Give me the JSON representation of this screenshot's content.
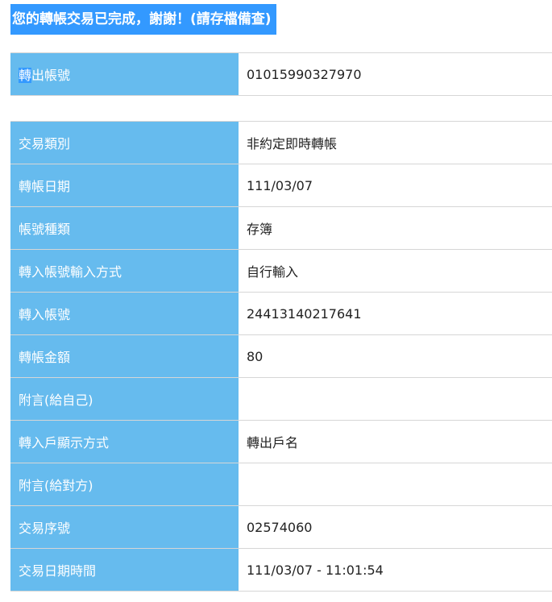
{
  "title": "您的轉帳交易已完成，謝謝！(請存檔備查)",
  "account_table": {
    "label_highlighted_char": "轉",
    "label_rest": "出帳號",
    "value": "01015990327970"
  },
  "details": [
    {
      "label": "交易類別",
      "value": "非約定即時轉帳"
    },
    {
      "label": "轉帳日期",
      "value": "111/03/07"
    },
    {
      "label": "帳號種類",
      "value": "存簿"
    },
    {
      "label": "轉入帳號輸入方式",
      "value": "自行輸入"
    },
    {
      "label": "轉入帳號",
      "value": "24413140217641"
    },
    {
      "label": "轉帳金額",
      "value": "80"
    },
    {
      "label": "附言(給自己)",
      "value": ""
    },
    {
      "label": "轉入戶顯示方式",
      "value": "轉出戶名"
    },
    {
      "label": "附言(給對方)",
      "value": ""
    },
    {
      "label": "交易序號",
      "value": "02574060"
    },
    {
      "label": "交易日期時間",
      "value": "111/03/07 - 11:01:54"
    }
  ],
  "colors": {
    "title_background": "#3399ff",
    "label_background": "#66bbee",
    "label_text": "#ffffff",
    "value_text": "#222222"
  }
}
